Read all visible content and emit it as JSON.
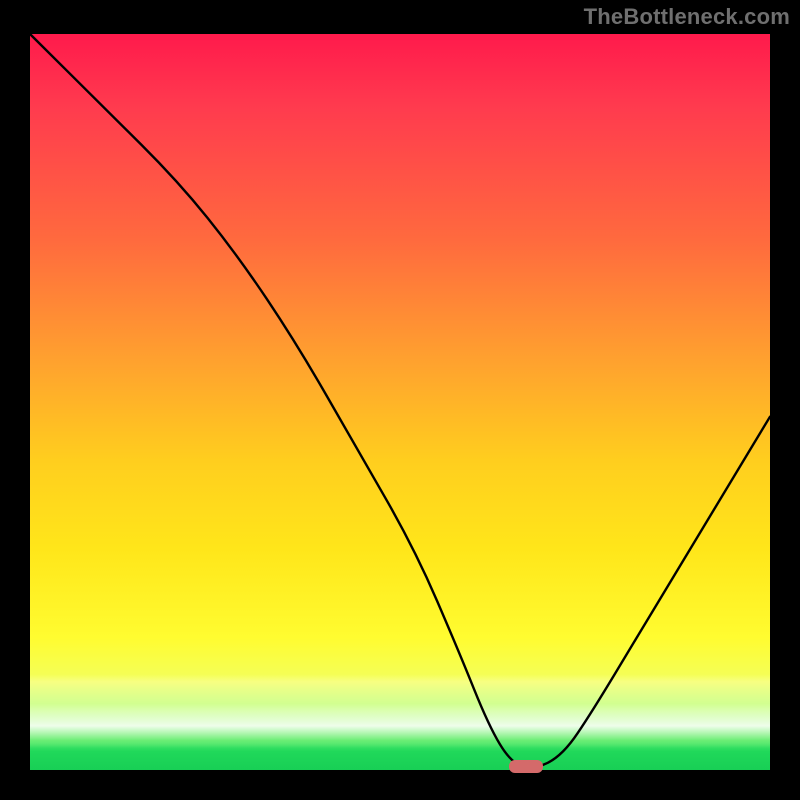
{
  "attribution": "TheBottleneck.com",
  "chart_data": {
    "type": "line",
    "title": "",
    "xlabel": "",
    "ylabel": "",
    "xlim": [
      0,
      100
    ],
    "ylim": [
      0,
      100
    ],
    "grid": false,
    "legend": false,
    "x": [
      0,
      10,
      20,
      28,
      36,
      44,
      52,
      58,
      62,
      65,
      68,
      72,
      76,
      82,
      88,
      94,
      100
    ],
    "values": [
      100,
      90,
      80,
      70,
      58,
      44,
      30,
      16,
      6,
      1,
      0,
      2,
      8,
      18,
      28,
      38,
      48
    ],
    "marker": {
      "x": 67,
      "y": 0,
      "color": "#d46a6a",
      "shape": "pill"
    },
    "background_gradient": {
      "type": "vertical",
      "stops": [
        {
          "pos": 0.0,
          "color": "#ff1a4c"
        },
        {
          "pos": 0.28,
          "color": "#ff6a3e"
        },
        {
          "pos": 0.58,
          "color": "#ffce1e"
        },
        {
          "pos": 0.82,
          "color": "#fffc30"
        },
        {
          "pos": 0.96,
          "color": "#4fe86e"
        },
        {
          "pos": 1.0,
          "color": "#18cf55"
        }
      ]
    }
  }
}
